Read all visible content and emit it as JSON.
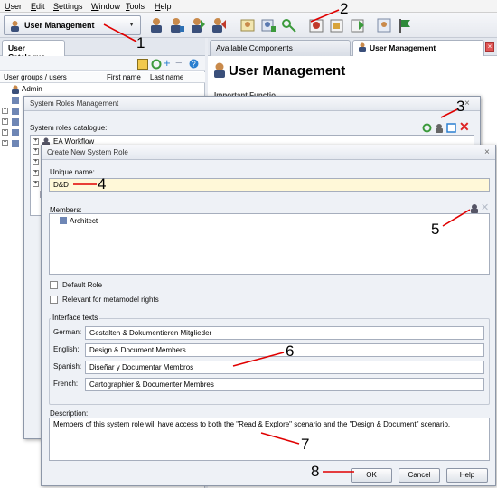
{
  "menubar": {
    "items": [
      "User",
      "Edit",
      "Settings",
      "Window",
      "Tools",
      "Help"
    ]
  },
  "toolbar": {
    "module_select": "User Management"
  },
  "left_panel": {
    "tab": "User Catalogue",
    "columns": [
      "User groups / users",
      "First name",
      "Last name"
    ],
    "rows": [
      "Admin"
    ]
  },
  "right_panel": {
    "tabs": [
      "Available Components",
      "User Management"
    ],
    "title": "User Management",
    "partial_text": "Important Functio"
  },
  "roles_window": {
    "title": "System Roles Management",
    "catalogue_label": "System roles catalogue:",
    "items": [
      "EA Workflow"
    ]
  },
  "create_dialog": {
    "title": "Create New System Role",
    "unique_name_label": "Unique name:",
    "unique_name_value": "D&D",
    "members_label": "Members:",
    "members": [
      "Architect"
    ],
    "default_role_label": "Default Role",
    "relevant_label": "Relevant for metamodel rights",
    "interface_texts_label": "Interface texts",
    "languages": [
      {
        "label": "German:",
        "value": "Gestalten & Dokumentieren Mitglieder"
      },
      {
        "label": "English:",
        "value": "Design & Document Members"
      },
      {
        "label": "Spanish:",
        "value": "Diseñar y Documentar Membros"
      },
      {
        "label": "French:",
        "value": "Cartographier & Documenter Membres"
      }
    ],
    "description_label": "Description:",
    "description_value": "Members of this system role will have access to both the \"Read & Explore\" scenario and the \"Design & Document\" scenario.",
    "ok_label": "OK",
    "cancel_label": "Cancel",
    "help_label": "Help"
  },
  "annotations": [
    "1",
    "2",
    "3",
    "4",
    "5",
    "6",
    "7",
    "8"
  ],
  "colors": {
    "annotation": "#e00000",
    "name_field": "#fff8d8",
    "dialog_bg": "#eef1f6"
  },
  "icons": [
    "user-icon",
    "users-icon",
    "key-icon",
    "role-icon",
    "refresh-icon",
    "add-icon",
    "remove-icon",
    "help-icon",
    "close-icon"
  ]
}
